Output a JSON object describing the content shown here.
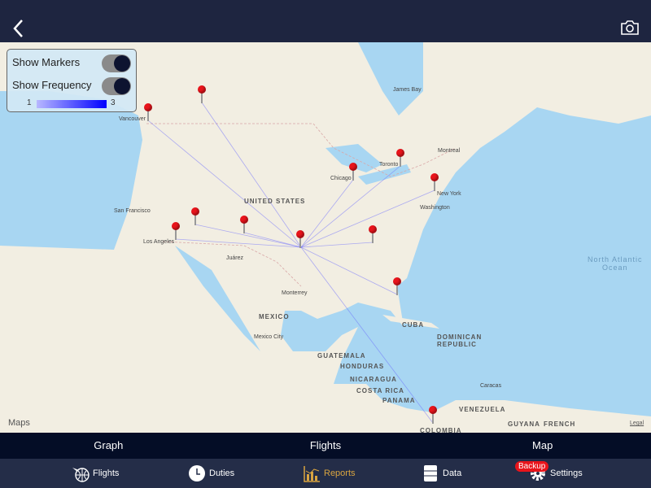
{
  "header": {
    "back_icon": "chevron-left-icon",
    "camera_icon": "camera-icon"
  },
  "panel": {
    "show_markers_label": "Show Markers",
    "show_markers": true,
    "show_frequency_label": "Show Frequency",
    "show_frequency": true,
    "legend_min": "1",
    "legend_max": "3",
    "legend_colors": [
      "#b8b8ff",
      "#0000ff"
    ]
  },
  "map": {
    "labels": {
      "vancouver": "Vancouver",
      "james_bay": "James Bay",
      "toronto": "Toronto",
      "montreal": "Montreal",
      "chicago": "Chicago",
      "new_york": "New York",
      "washington": "Washington",
      "united_states": "UNITED STATES",
      "san_francisco": "San Francisco",
      "los_angeles": "Los Angeles",
      "juarez": "Juárez",
      "monterrey": "Monterrey",
      "mexico": "MEXICO",
      "mexico_city": "Mexico City",
      "cuba": "CUBA",
      "dominican_republic": "DOMINICAN\nREPUBLIC",
      "guatemala": "GUATEMALA",
      "honduras": "HONDURAS",
      "nicaragua": "NICARAGUA",
      "costa_rica": "COSTA RICA",
      "panama": "PANAMA",
      "venezuela": "VENEZUELA",
      "caracas": "Caracas",
      "guyana": "GUYANA",
      "french_guiana": "FRENCH",
      "colombia": "COLOMBIA",
      "ocean": "North Atlantic\nOcean"
    },
    "attribution": "Maps",
    "legal": "Legal",
    "marker_color": "#e8141b",
    "route_color": "#6666ff"
  },
  "segments": [
    {
      "label": "Graph"
    },
    {
      "label": "Flights"
    },
    {
      "label": "Map",
      "selected": true
    }
  ],
  "tabs": [
    {
      "label": "Flights",
      "icon": "plane-globe-icon"
    },
    {
      "label": "Duties",
      "icon": "clock-icon"
    },
    {
      "label": "Reports",
      "icon": "bar-chart-icon",
      "active": true
    },
    {
      "label": "Data",
      "icon": "cabinet-icon"
    },
    {
      "label": "Settings",
      "icon": "gear-icon",
      "badge": "Backup"
    }
  ],
  "active_color": "#d9a440"
}
